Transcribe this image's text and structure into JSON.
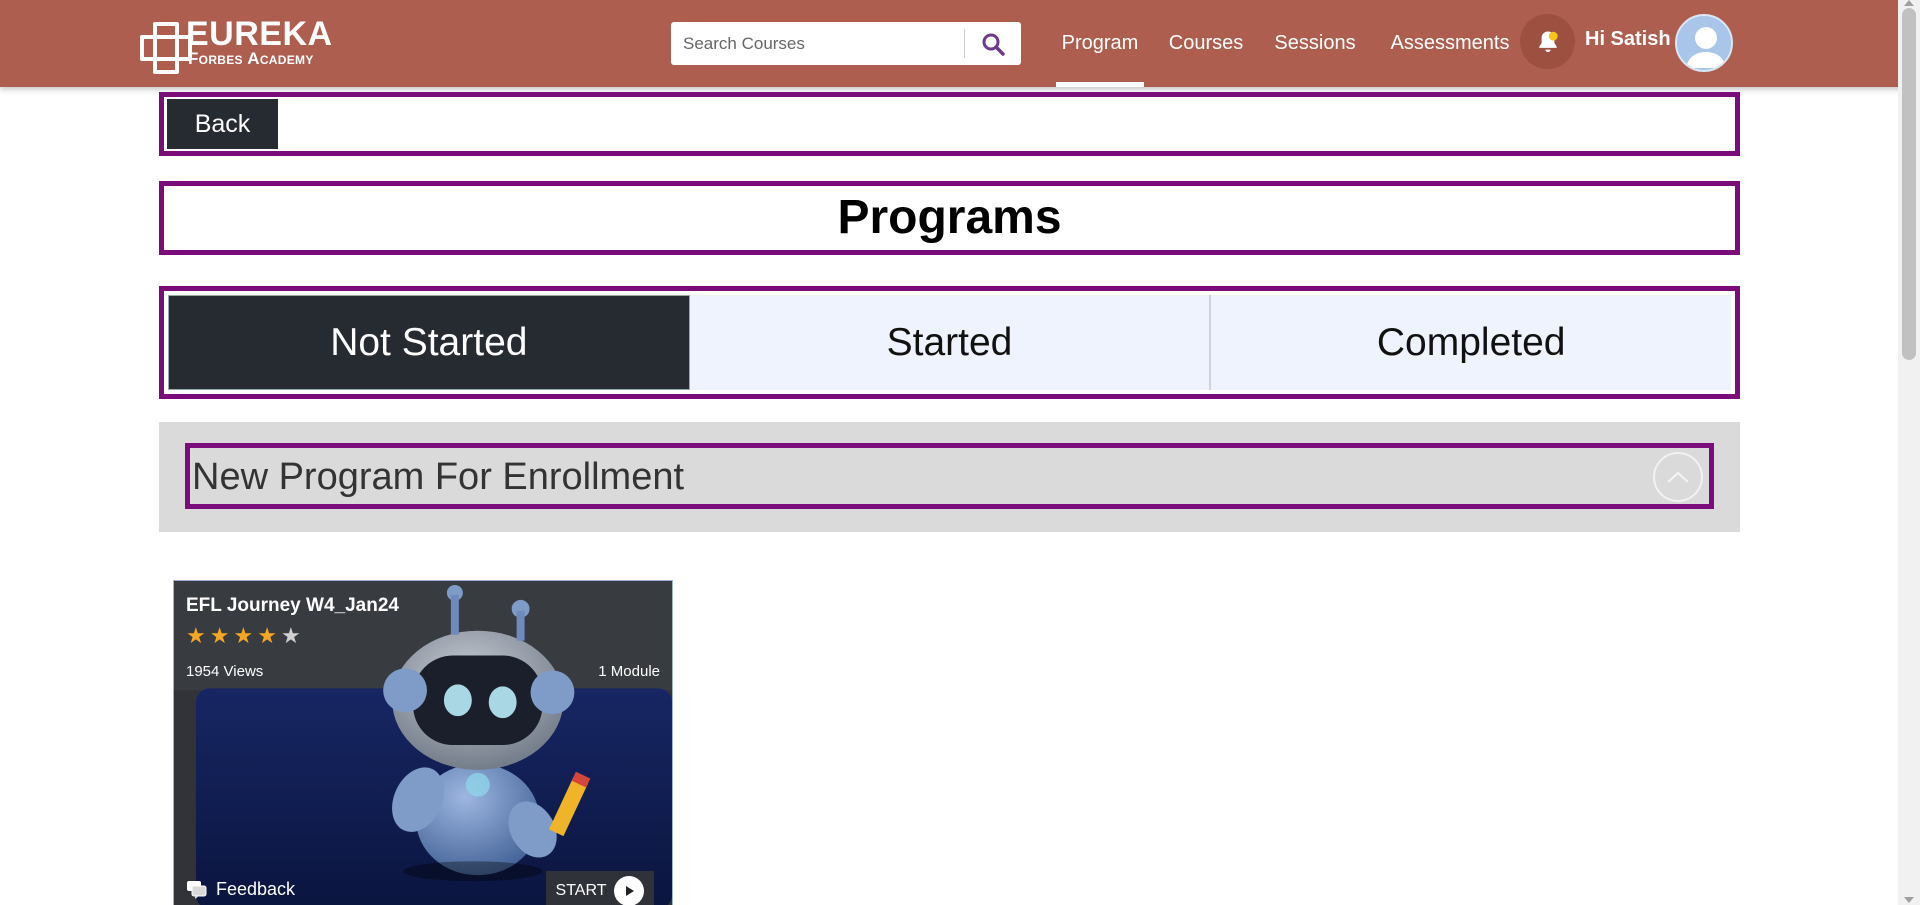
{
  "header": {
    "brand": "EUREKA",
    "brand_sub": "Forbes Academy",
    "search_placeholder": "Search Courses",
    "nav": [
      {
        "label": "Program",
        "active": true
      },
      {
        "label": "Courses",
        "active": false
      },
      {
        "label": "Sessions",
        "active": false
      },
      {
        "label": "Assessments",
        "active": false
      }
    ],
    "greeting": "Hi Satish",
    "accent_color": "#ad5e4f"
  },
  "back_label": "Back",
  "page_title": "Programs",
  "tabs": [
    {
      "label": "Not Started",
      "active": true
    },
    {
      "label": "Started",
      "active": false
    },
    {
      "label": "Completed",
      "active": false
    }
  ],
  "section": {
    "title": "New Program For Enrollment"
  },
  "programs": [
    {
      "title": "EFL Journey W4_Jan24",
      "rating": 4,
      "rating_max": 5,
      "views": "1954 Views",
      "modules": "1 Module",
      "feedback_label": "Feedback",
      "start_label": "START"
    }
  ],
  "icons": {
    "search": "search-icon",
    "bell": "bell-icon",
    "avatar": "user-avatar-icon",
    "collapse": "chevron-up-icon",
    "feedback": "feedback-icon",
    "play": "play-icon"
  },
  "colors": {
    "outline": "#7a0d7a",
    "dark": "#262a31",
    "tab_inactive": "#eef3fd",
    "section_band": "#dadada",
    "star_on": "#f5a623",
    "star_off": "#d0d0d0"
  }
}
